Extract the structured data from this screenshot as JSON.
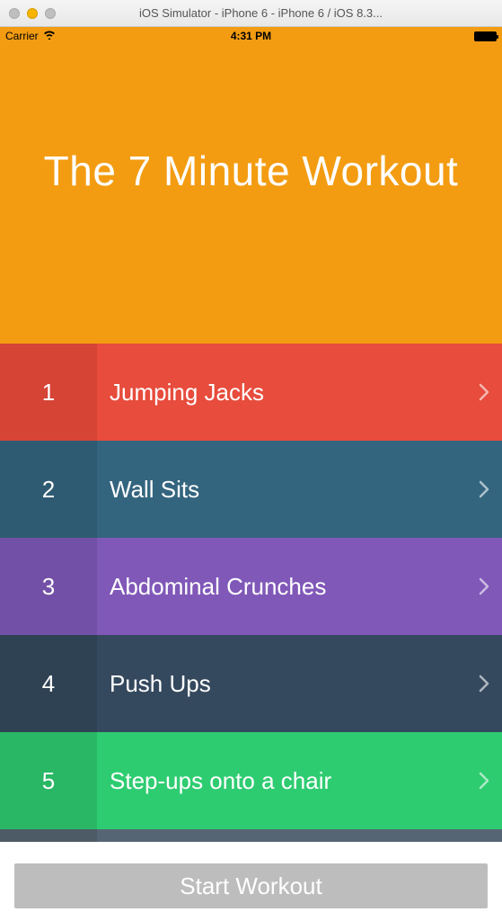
{
  "window": {
    "title": "iOS Simulator - iPhone 6 - iPhone 6 / iOS 8.3..."
  },
  "statusBar": {
    "carrier": "Carrier",
    "time": "4:31 PM"
  },
  "appTitle": "The 7 Minute Workout",
  "exercises": [
    {
      "num": "1",
      "label": "Jumping Jacks"
    },
    {
      "num": "2",
      "label": "Wall Sits"
    },
    {
      "num": "3",
      "label": "Abdominal Crunches"
    },
    {
      "num": "4",
      "label": "Push Ups"
    },
    {
      "num": "5",
      "label": "Step-ups onto a chair"
    }
  ],
  "startButton": "Start Workout"
}
